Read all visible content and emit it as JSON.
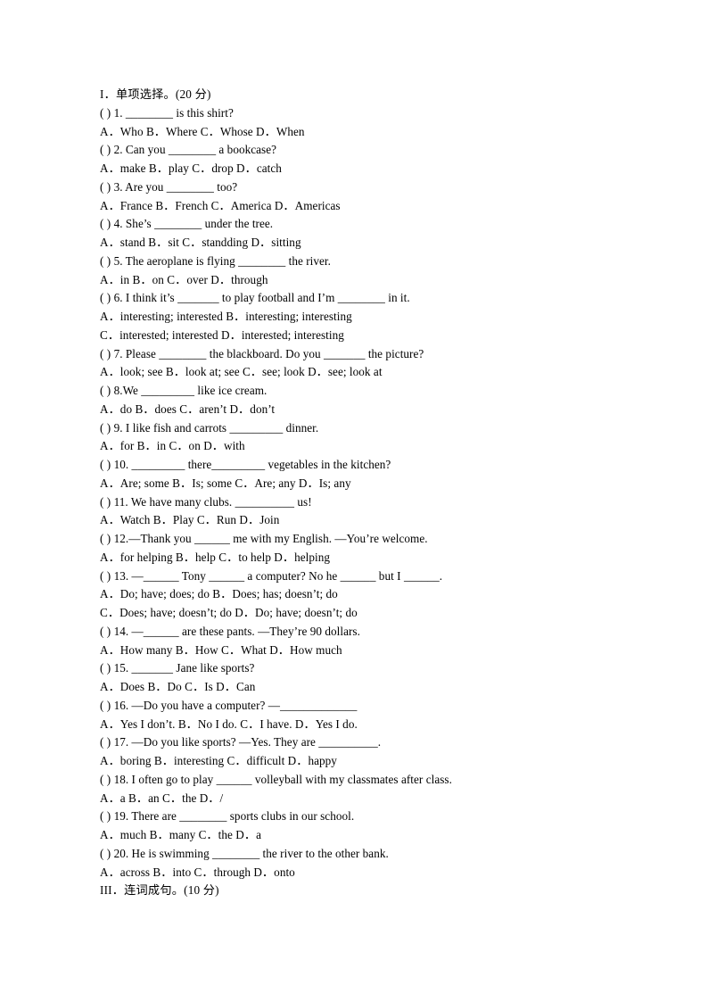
{
  "document": {
    "title": "I．单项选择。(20 分)",
    "language": "en-zh",
    "background_color": "#ffffff",
    "text_color": "#000000"
  },
  "sections": [
    {
      "heading": "I．单项选择。(20 分)",
      "heading_label": "section-1-heading"
    },
    {
      "heading": "III．连词成句。(10 分)",
      "heading_label": "section-3-heading"
    }
  ],
  "lines": [
    "I．单项选择。(20 分)",
    "( ) 1. ________ is this shirt?",
    "A．Who B．Where C．Whose D．When",
    "( ) 2. Can you ________ a bookcase?",
    "A．make B．play C．drop D．catch",
    "( ) 3. Are you ________ too?",
    "A．France B．French C．America D．Americas",
    "( ) 4. She’s ________ under the tree.",
    "A．stand B．sit C．standding D．sitting",
    "( ) 5. The aeroplane is flying ________ the river.",
    "A．in B．on C．over D．through",
    "( ) 6. I think it’s _______ to play football and I’m ________ in it.",
    "A．interesting; interested B．interesting; interesting",
    "C．interested; interested D．interested; interesting",
    "( ) 7. Please ________ the blackboard. Do you _______ the picture?",
    "A．look; see B．look at; see C．see; look D．see; look at",
    "( ) 8.We _________ like ice cream.",
    "A．do B．does C．aren’t D．don’t",
    "( ) 9. I like fish and carrots _________ dinner.",
    "A．for B．in C．on D．with",
    "( ) 10. _________ there_________ vegetables in the kitchen?",
    "A．Are; some B．Is; some C．Are; any D．Is; any",
    "( ) 11. We have many clubs. __________ us!",
    "A．Watch B．Play C．Run D．Join",
    "( ) 12.—Thank you ______ me with my English. —You’re welcome.",
    "A．for helping B．help C．to help D．helping",
    "( ) 13. —______ Tony ______ a computer? No he ______ but I ______.",
    "A．Do; have; does; do B．Does; has; doesn’t; do",
    "C．Does; have; doesn’t; do D．Do; have; doesn’t; do",
    "( ) 14. —______ are these pants. —They’re 90 dollars.",
    "A．How many B．How C．What D．How much",
    "( ) 15. _______ Jane like sports?",
    "A．Does B．Do C．Is D．Can",
    "( ) 16. —Do you have a computer? —_____________",
    "A．Yes I don’t. B．No I do. C．I have. D．Yes I do.",
    "( ) 17. —Do you like sports? —Yes. They are __________.",
    "A．boring B．interesting C．difficult D．happy",
    "( ) 18. I often go to play ______ volleyball with my classmates after class.",
    "A．a B．an C．the D．/",
    "( ) 19. There are ________ sports clubs in our school.",
    "A．much B．many C．the D．a",
    "( ) 20. He is swimming ________ the river to the other bank.",
    "A．across B．into C．through D．onto",
    "III．连词成句。(10 分)"
  ],
  "questions": [
    {
      "number": "1",
      "stem": "( ) 1. ________ is this shirt?",
      "options": "A．Who B．Where C．Whose D．When"
    },
    {
      "number": "2",
      "stem": "( ) 2. Can you ________ a bookcase?",
      "options": "A．make B．play C．drop D．catch"
    },
    {
      "number": "3",
      "stem": "( ) 3. Are you ________ too?",
      "options": "A．France B．French C．America D．Americas"
    },
    {
      "number": "4",
      "stem": "( ) 4. She’s ________ under the tree.",
      "options": "A．stand B．sit C．standding D．sitting"
    },
    {
      "number": "5",
      "stem": "( ) 5. The aeroplane is flying ________ the river.",
      "options": "A．in B．on C．over D．through"
    },
    {
      "number": "6",
      "stem": "( ) 6. I think it’s _______ to play football and I’m ________ in it.",
      "options": "A．interesting; interested B．interesting; interesting / C．interested; interested D．interested; interesting"
    },
    {
      "number": "7",
      "stem": "( ) 7. Please ________ the blackboard. Do you _______ the picture?",
      "options": "A．look; see B．look at; see C．see; look D．see; look at"
    },
    {
      "number": "8",
      "stem": "( ) 8.We _________ like ice cream.",
      "options": "A．do B．does C．aren’t D．don’t"
    },
    {
      "number": "9",
      "stem": "( ) 9. I like fish and carrots _________ dinner.",
      "options": "A．for B．in C．on D．with"
    },
    {
      "number": "10",
      "stem": "( ) 10. _________ there_________ vegetables in the kitchen?",
      "options": "A．Are; some B．Is; some C．Are; any D．Is; any"
    },
    {
      "number": "11",
      "stem": "( ) 11. We have many clubs. __________ us!",
      "options": "A．Watch B．Play C．Run D．Join"
    },
    {
      "number": "12",
      "stem": "( ) 12.—Thank you ______ me with my English. —You’re welcome.",
      "options": "A．for helping B．help C．to help D．helping"
    },
    {
      "number": "13",
      "stem": "( ) 13. —______ Tony ______ a computer? No he ______ but I ______.",
      "options": "A．Do; have; does; do B．Does; has; doesn’t; do / C．Does; have; doesn’t; do D．Do; have; doesn’t; do"
    },
    {
      "number": "14",
      "stem": "( ) 14. —______ are these pants. —They’re 90 dollars.",
      "options": "A．How many B．How C．What D．How much"
    },
    {
      "number": "15",
      "stem": "( ) 15. _______ Jane like sports?",
      "options": "A．Does B．Do C．Is D．Can"
    },
    {
      "number": "16",
      "stem": "( ) 16. —Do you have a computer? —_____________",
      "options": "A．Yes I don’t. B．No I do. C．I have. D．Yes I do."
    },
    {
      "number": "17",
      "stem": "( ) 17. —Do you like sports? —Yes. They are __________.",
      "options": "A．boring B．interesting C．difficult D．happy"
    },
    {
      "number": "18",
      "stem": "( ) 18. I often go to play ______ volleyball with my classmates after class.",
      "options": "A．a B．an C．the D．/"
    },
    {
      "number": "19",
      "stem": "( ) 19. There are ________ sports clubs in our school.",
      "options": "A．much B．many C．the D．a"
    },
    {
      "number": "20",
      "stem": "( ) 20. He is swimming ________ the river to the other bank.",
      "options": "A．across B．into C．through D．onto"
    }
  ]
}
